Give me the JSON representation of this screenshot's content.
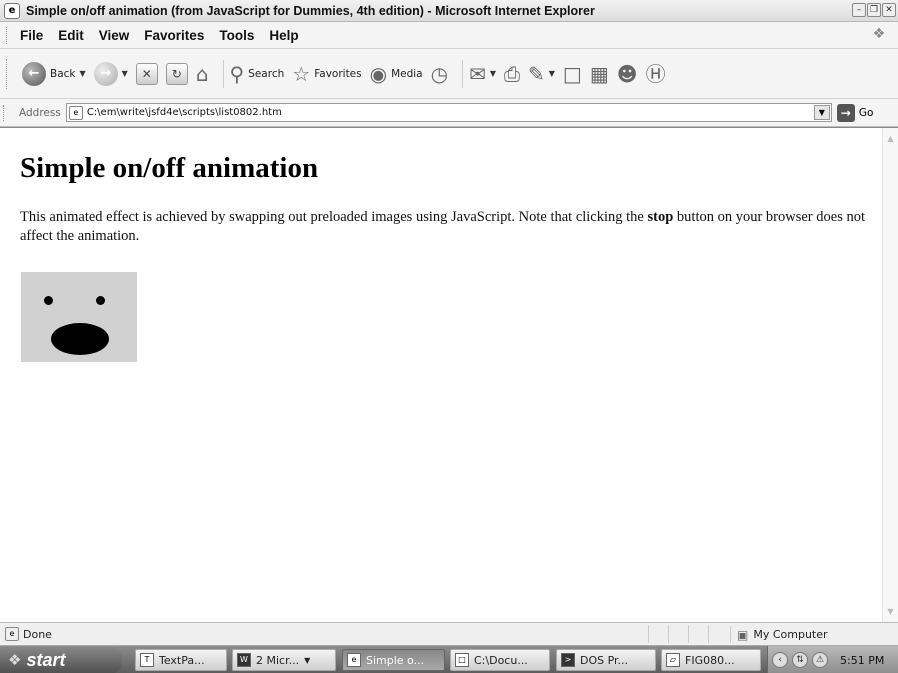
{
  "window": {
    "title": "Simple on/off animation (from JavaScript for Dummies, 4th edition) - Microsoft Internet Explorer"
  },
  "menu": {
    "items": [
      {
        "label": "File"
      },
      {
        "label": "Edit"
      },
      {
        "label": "View"
      },
      {
        "label": "Favorites"
      },
      {
        "label": "Tools"
      },
      {
        "label": "Help"
      }
    ]
  },
  "toolbar": {
    "back_label": "Back",
    "search_label": "Search",
    "favorites_label": "Favorites",
    "media_label": "Media"
  },
  "address": {
    "label": "Address",
    "url": "C:\\em\\write\\jsfd4e\\scripts\\list0802.htm",
    "go_label": "Go"
  },
  "page": {
    "heading": "Simple on/off animation",
    "text_part1": "This animated effect is achieved by swapping out preloaded images using JavaScript. Note that clicking the ",
    "text_bold": "stop",
    "text_part2": " button on your browser does not affect the animation."
  },
  "status": {
    "text": "Done",
    "zone": "My Computer"
  },
  "taskbar": {
    "start_label": "start",
    "tasks": [
      {
        "label": "TextPa..."
      },
      {
        "label": "2 Micr..."
      },
      {
        "label": "Simple o..."
      },
      {
        "label": "C:\\Docu..."
      },
      {
        "label": "DOS Pr..."
      },
      {
        "label": "FIG080..."
      }
    ],
    "clock": "5:51 PM"
  }
}
